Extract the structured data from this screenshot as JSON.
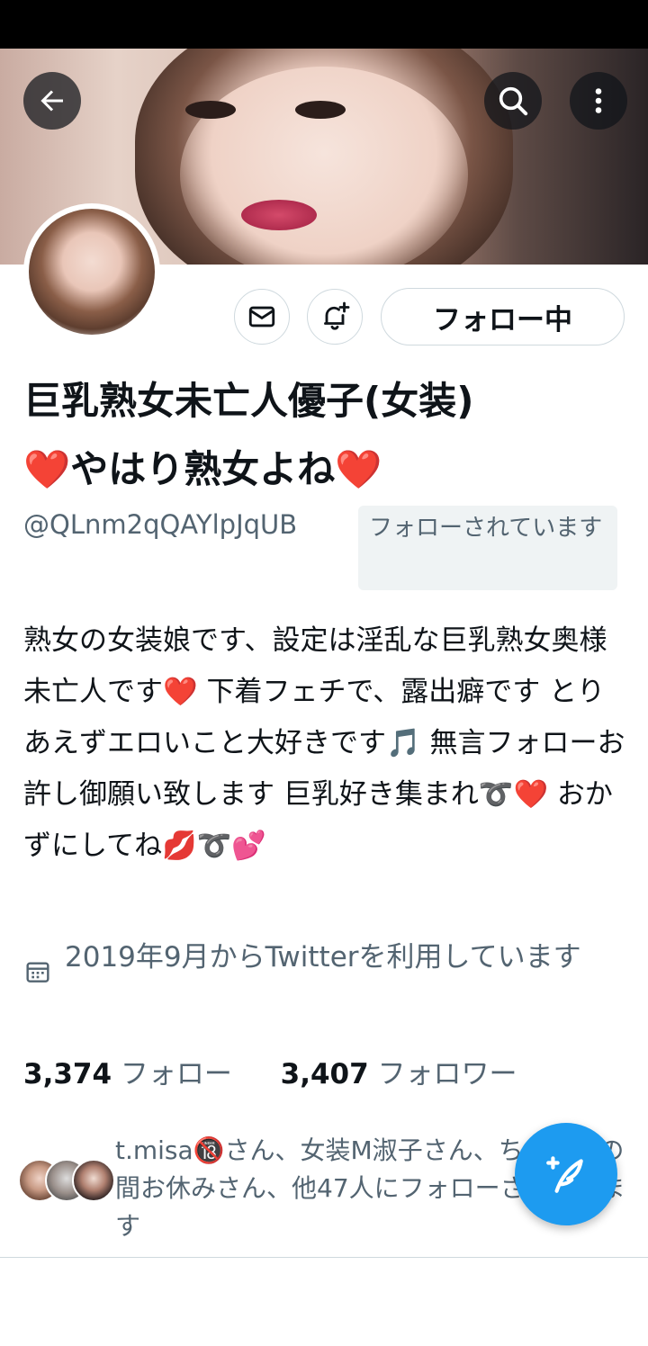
{
  "profile": {
    "name_line1": "巨乳熟女未亡人優子(女装)",
    "name_line2": "やはり熟女よね",
    "name_heart": "❤️",
    "handle": "@QLnm2qQAYlpJqUB",
    "follows_you": "フォローされています",
    "bio": "熟女の女装娘です、設定は淫乱な巨乳熟女奥様未亡人です❤️ 下着フェチで、露出癖です とりあえずエロいこと大好きです🎵 無言フォローお許し御願い致します 巨乳好き集まれ➰❤️ おかずにしてね💋➰💕",
    "joined": "2019年9月からTwitterを利用しています",
    "following_count": "3,374",
    "following_label": "フォロー",
    "followers_count": "3,407",
    "followers_label": "フォロワー"
  },
  "actions": {
    "follow_state": "フォロー中"
  },
  "followed_by": {
    "text": "t.misa🔞さん、女装M淑子さん、ちょっとの間お休みさん、他47人にフォローされています"
  },
  "icons": {
    "back": "back-arrow-icon",
    "search": "search-icon",
    "more": "more-vertical-icon",
    "message": "envelope-icon",
    "notify": "bell-plus-icon",
    "calendar": "calendar-icon",
    "compose": "compose-feather-icon"
  },
  "colors": {
    "accent": "#1d9bf0",
    "text": "#0f1419",
    "secondary": "#536471",
    "border": "#cfd9de"
  }
}
